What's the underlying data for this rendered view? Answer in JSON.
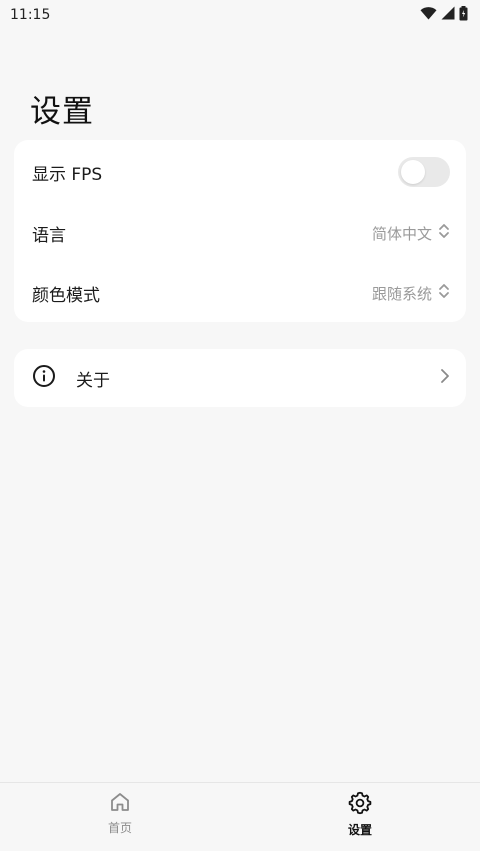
{
  "status_bar": {
    "time": "11:15",
    "icons": [
      "wifi-icon",
      "signal-icon",
      "battery-icon"
    ]
  },
  "page": {
    "title": "设置"
  },
  "settings": {
    "show_fps": {
      "label": "显示 FPS",
      "enabled": false
    },
    "language": {
      "label": "语言",
      "value": "简体中文"
    },
    "color_mode": {
      "label": "颜色模式",
      "value": "跟随系统"
    }
  },
  "about": {
    "label": "关于"
  },
  "bottom_nav": {
    "items": [
      {
        "label": "首页",
        "icon": "home-icon",
        "active": false
      },
      {
        "label": "设置",
        "icon": "gear-icon",
        "active": true
      }
    ]
  },
  "colors": {
    "background": "#f7f7f7",
    "card": "#ffffff",
    "secondary_text": "#9a9a9a",
    "toggle_off": "#e9e9e9"
  }
}
